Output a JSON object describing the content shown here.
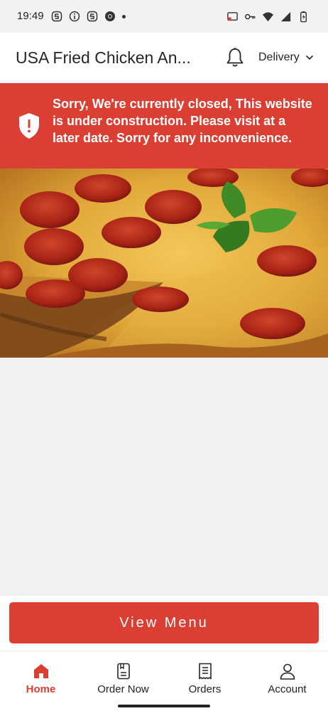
{
  "status_bar": {
    "time": "19:49",
    "left_icons": [
      "s-app-icon",
      "info-icon",
      "s-app-icon",
      "chrome-icon",
      "dot-icon"
    ],
    "right_icons": [
      "cast-icon",
      "key-icon",
      "wifi-icon",
      "signal-icon",
      "battery-icon"
    ]
  },
  "header": {
    "title": "USA Fried Chicken An...",
    "bell_icon": "bell-icon",
    "delivery_label": "Delivery",
    "delivery_icon": "chevron-down-icon"
  },
  "banner": {
    "icon": "shield-alert-icon",
    "message": "Sorry, We're currently closed, This website is under construction. Please visit at a later date. Sorry for any inconvenience.",
    "color": "#db3f33"
  },
  "hero": {
    "image": "pepperoni-pizza-image"
  },
  "cta": {
    "label": "View Menu",
    "color": "#db3f33"
  },
  "bottom_nav": {
    "items": [
      {
        "label": "Home",
        "icon": "home-icon",
        "active": true
      },
      {
        "label": "Order Now",
        "icon": "order-icon",
        "active": false
      },
      {
        "label": "Orders",
        "icon": "receipt-icon",
        "active": false
      },
      {
        "label": "Account",
        "icon": "account-icon",
        "active": false
      }
    ],
    "active_color": "#db3f33"
  }
}
